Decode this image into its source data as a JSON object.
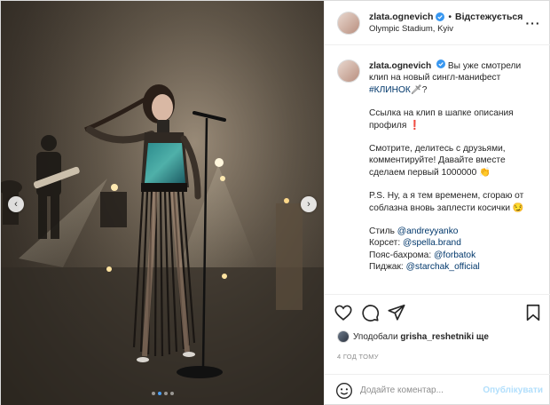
{
  "header": {
    "username": "zlata.ognevich",
    "separator": "•",
    "follow_label": "Відстежується",
    "location": "Olympic Stadium, Kyiv",
    "more_label": "···"
  },
  "caption": {
    "username": "zlata.ognevich",
    "line1": "Вы уже смотрели клип на новый сингл-манифест ",
    "hashtag": "#КЛИНОК",
    "line1_end": "🗡?",
    "p2": "Ссылка на клип в шапке описания профиля ❗",
    "p3": "Смотрите, делитесь с друзьями, комментируйте! Давайте вместе сделаем первый 1000000 👏",
    "p4": "P.S. Ну, а я тем временем, сгораю от соблазна вновь заплести косички 😏",
    "credits": [
      {
        "prefix": "Стиль ",
        "handle": "@andreyyanko"
      },
      {
        "prefix": "Корсет: ",
        "handle": "@spella.brand"
      },
      {
        "prefix": "Пояс-бахрома: ",
        "handle": "@forbatok"
      },
      {
        "prefix": "Пиджак: ",
        "handle": "@starchak_official"
      }
    ]
  },
  "likes": {
    "prefix": "Уподобали ",
    "user": "grisha_reshetnik",
    "suffix": " і ще"
  },
  "time": "4 ГОД ТОМУ",
  "comment": {
    "placeholder": "Додайте коментар...",
    "publish_label": "Опублікувати"
  },
  "media": {
    "nav_left": "‹",
    "nav_right": "›",
    "dots_total": 4,
    "dot_active": 1
  },
  "icons": {
    "verified": "verified-badge-icon",
    "like": "heart-icon",
    "comment": "comment-icon",
    "share": "share-icon",
    "save": "bookmark-icon",
    "emoji": "emoji-icon"
  },
  "colors": {
    "link": "#00376b",
    "verified": "#3897f0",
    "publish_disabled": "#b2dffc"
  }
}
